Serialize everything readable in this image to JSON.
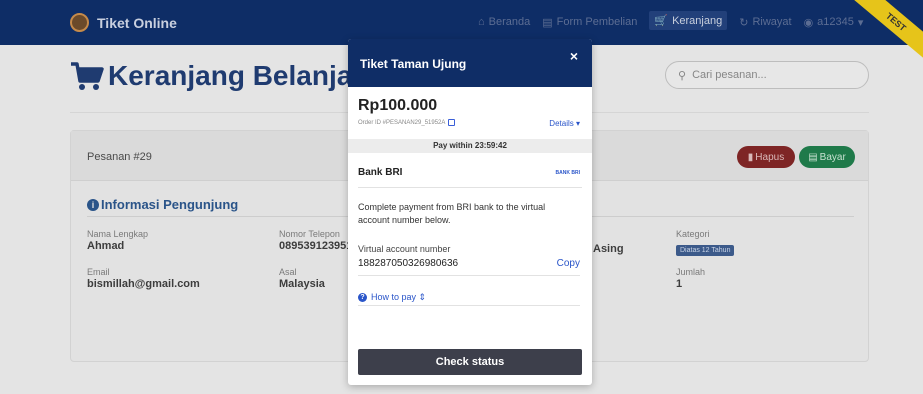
{
  "navbar": {
    "brand": "Tiket Online",
    "links": [
      {
        "icon": "home-icon",
        "label": "Beranda"
      },
      {
        "icon": "form-icon",
        "label": "Form Pembelian"
      },
      {
        "icon": "cart-icon",
        "label": "Keranjang",
        "active": true
      },
      {
        "icon": "history-icon",
        "label": "Riwayat"
      },
      {
        "icon": "user-icon",
        "label": "a12345"
      }
    ],
    "ribbon": "TEST",
    "accent": "#0e2d66",
    "ribbon_color": "#e6c41a"
  },
  "page": {
    "title": "Keranjang Belanja",
    "search_placeholder": "Cari pesanan..."
  },
  "order": {
    "label": "Pesanan #29",
    "delete_label": "Hapus",
    "pay_label": "Bayar",
    "section_title": "Informasi Pengunjung",
    "fields": {
      "name": {
        "label": "Nama Lengkap",
        "value": "Ahmad"
      },
      "phone": {
        "label": "Nomor Telepon",
        "value": "089539123951"
      },
      "email": {
        "label": "Email",
        "value": "bismillah@gmail.com"
      },
      "origin": {
        "label": "Asal",
        "value": "Malaysia"
      },
      "type": {
        "value": "Asing"
      },
      "category": {
        "label": "Kategori",
        "value": "Diatas 12 Tahun"
      },
      "count": {
        "label": "Jumlah",
        "value": "1"
      }
    }
  },
  "modal": {
    "title": "Tiket Taman Ujung",
    "close": "×",
    "amount": "Rp100.000",
    "order_id": "Order ID #PESANAN29_51952A",
    "details": "Details ▾",
    "pay_within": "Pay within 23:59:42",
    "bank": "Bank BRI",
    "bank_logo": "BANK BRI",
    "description": "Complete payment from BRI bank to the virtual account number below.",
    "va_label": "Virtual account number",
    "va_number": "188287050326980636",
    "copy": "Copy",
    "how_to_pay": "How to pay ⇕",
    "check_status": "Check status"
  }
}
